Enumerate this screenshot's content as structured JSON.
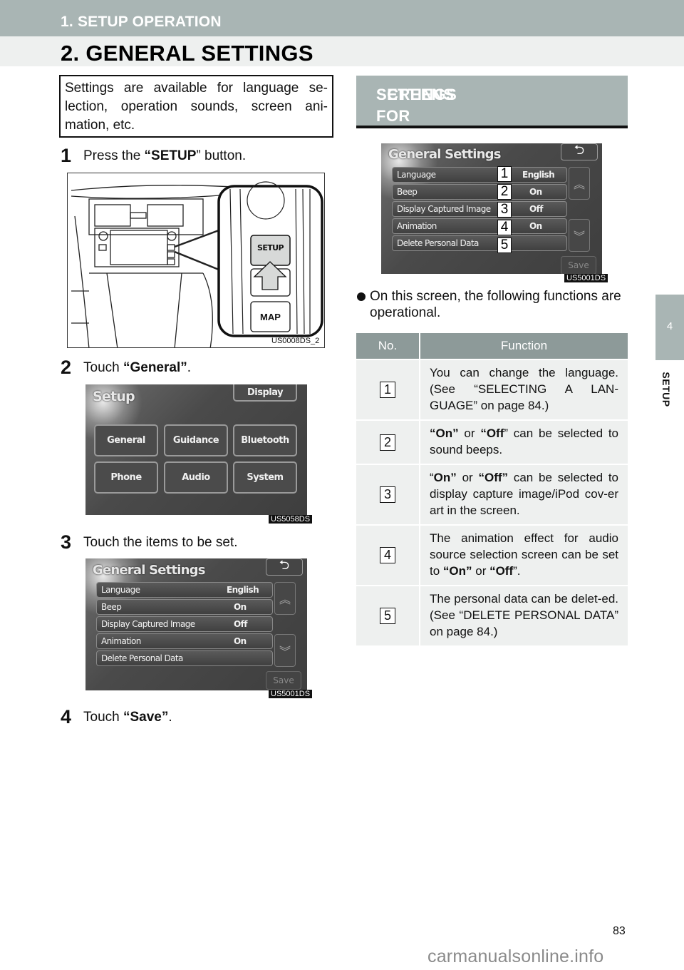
{
  "header": {
    "section": "1. SETUP OPERATION",
    "title": "2. GENERAL SETTINGS"
  },
  "side_tab": {
    "chapter_number": "4",
    "chapter_label": "SETUP"
  },
  "intro": "Settings are available for language se-lection, operation sounds, screen ani-mation, etc.",
  "steps": [
    {
      "num": "1",
      "pre": "Press the ",
      "bold": "“SETUP",
      "post": "” button."
    },
    {
      "num": "2",
      "pre": "Touch ",
      "bold": "“General”",
      "post": "."
    },
    {
      "num": "3",
      "pre": "Touch the items to be set.",
      "bold": "",
      "post": ""
    },
    {
      "num": "4",
      "pre": "Touch ",
      "bold": "“Save”",
      "post": "."
    }
  ],
  "figures": {
    "dash": {
      "code": "US0008DS_2",
      "setup_button": "SETUP",
      "map_button": "MAP"
    },
    "setup_menu": {
      "code": "US5058DS",
      "title": "Setup",
      "display_button": "Display",
      "buttons": [
        "General",
        "Guidance",
        "Bluetooth",
        "Phone",
        "Audio",
        "System"
      ]
    },
    "general_settings": {
      "code": "US5001DS",
      "title": "General Settings",
      "back_icon": "return-arrow-icon",
      "save_button": "Save",
      "rows": [
        {
          "label": "Language",
          "value": "English"
        },
        {
          "label": "Beep",
          "value": "On"
        },
        {
          "label": "Display Captured Image",
          "value": "Off"
        },
        {
          "label": "Animation",
          "value": "On"
        },
        {
          "label": "Delete Personal Data",
          "value": ""
        }
      ],
      "markers": [
        "1",
        "2",
        "3",
        "4",
        "5"
      ]
    }
  },
  "screens_section": {
    "heading_line1": "SCREENS FOR GENERAL",
    "heading_line2": "SETTINGS",
    "bullet": "On this screen, the following functions are operational."
  },
  "function_table": {
    "headers": [
      "No.",
      "Function"
    ],
    "rows": [
      {
        "no": "1",
        "parts": [
          {
            "t": "You can change the language. (See “SELECTING A LAN-GUAGE” on page 84.)",
            "b": false
          }
        ]
      },
      {
        "no": "2",
        "parts": [
          {
            "t": "“On”",
            "b": true
          },
          {
            "t": " or ",
            "b": false
          },
          {
            "t": "“Off",
            "b": true
          },
          {
            "t": "” can be selected to sound beeps.",
            "b": false
          }
        ]
      },
      {
        "no": "3",
        "parts": [
          {
            "t": "“",
            "b": false
          },
          {
            "t": "On”",
            "b": true
          },
          {
            "t": " or ",
            "b": false
          },
          {
            "t": "“Off”",
            "b": true
          },
          {
            "t": " can be selected to display capture image/iPod cov-er art in the screen.",
            "b": false
          }
        ]
      },
      {
        "no": "4",
        "parts": [
          {
            "t": "The animation effect for audio source selection screen can be set to ",
            "b": false
          },
          {
            "t": "“On”",
            "b": true
          },
          {
            "t": " or ",
            "b": false
          },
          {
            "t": "“Off",
            "b": true
          },
          {
            "t": "”.",
            "b": false
          }
        ]
      },
      {
        "no": "5",
        "parts": [
          {
            "t": "The personal data can be delet-ed. (See “DELETE PERSONAL DATA” on page 84.)",
            "b": false
          }
        ]
      }
    ]
  },
  "footer": {
    "page_number": "83",
    "watermark": "carmanualsonline.info"
  }
}
